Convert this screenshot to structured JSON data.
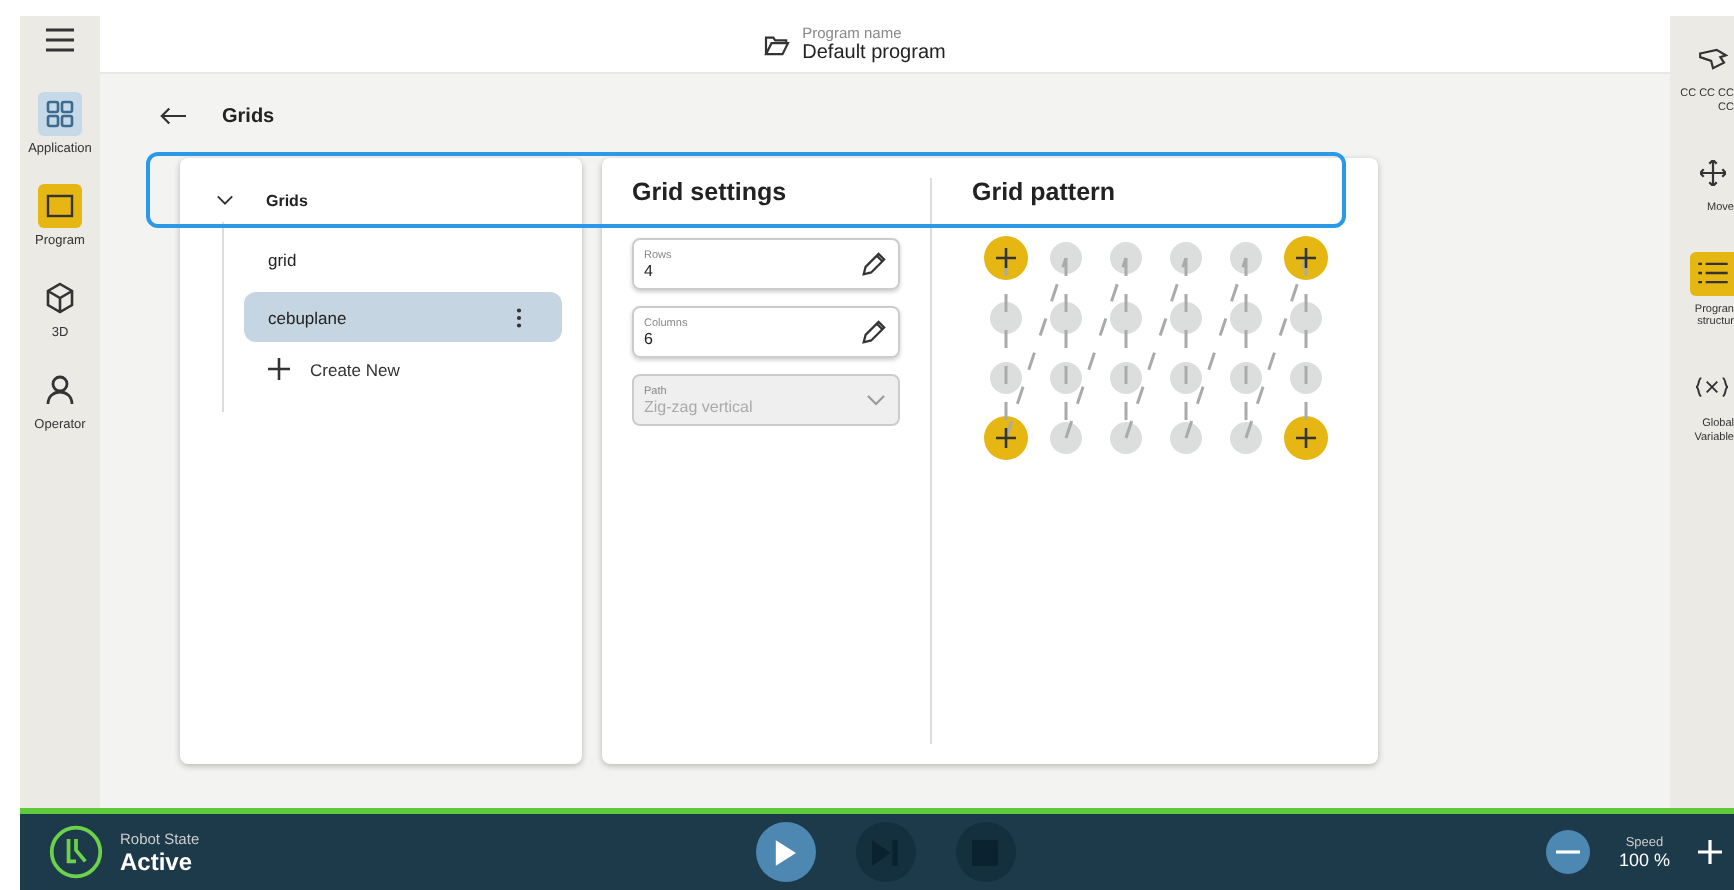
{
  "header": {
    "label": "Program name",
    "value": "Default program"
  },
  "left_nav": [
    {
      "label": "Application",
      "selected": false,
      "highlighted": true
    },
    {
      "label": "Program",
      "selected": true,
      "highlighted": false
    },
    {
      "label": "3D",
      "selected": false,
      "highlighted": false
    },
    {
      "label": "Operator",
      "selected": false,
      "highlighted": false
    }
  ],
  "page_title": "Grids",
  "tree": {
    "title": "Grids",
    "expanded": true,
    "children": [
      {
        "label": "grid",
        "selected": false
      },
      {
        "label": "cebuplane",
        "selected": true
      }
    ],
    "create_label": "Create New"
  },
  "grid_settings": {
    "title": "Grid settings",
    "rows": {
      "label": "Rows",
      "value": "4"
    },
    "columns": {
      "label": "Columns",
      "value": "6"
    },
    "path": {
      "label": "Path",
      "value": "Zig-zag vertical",
      "disabled": true
    }
  },
  "grid_pattern": {
    "title": "Grid pattern"
  },
  "right_nav": [
    {
      "label": "CC CC CC CC",
      "selected": false
    },
    {
      "label": "Move",
      "selected": false
    },
    {
      "label": "Progran structur",
      "selected": true
    },
    {
      "label": "Global Variable",
      "selected": false
    }
  ],
  "status_bar": {
    "state_label": "Robot State",
    "state_value": "Active",
    "controls": [
      {
        "kind": "play",
        "disabled": false
      },
      {
        "kind": "step",
        "disabled": true
      },
      {
        "kind": "stop",
        "disabled": true
      }
    ],
    "speed_label": "Speed",
    "speed_value": "100 %"
  }
}
